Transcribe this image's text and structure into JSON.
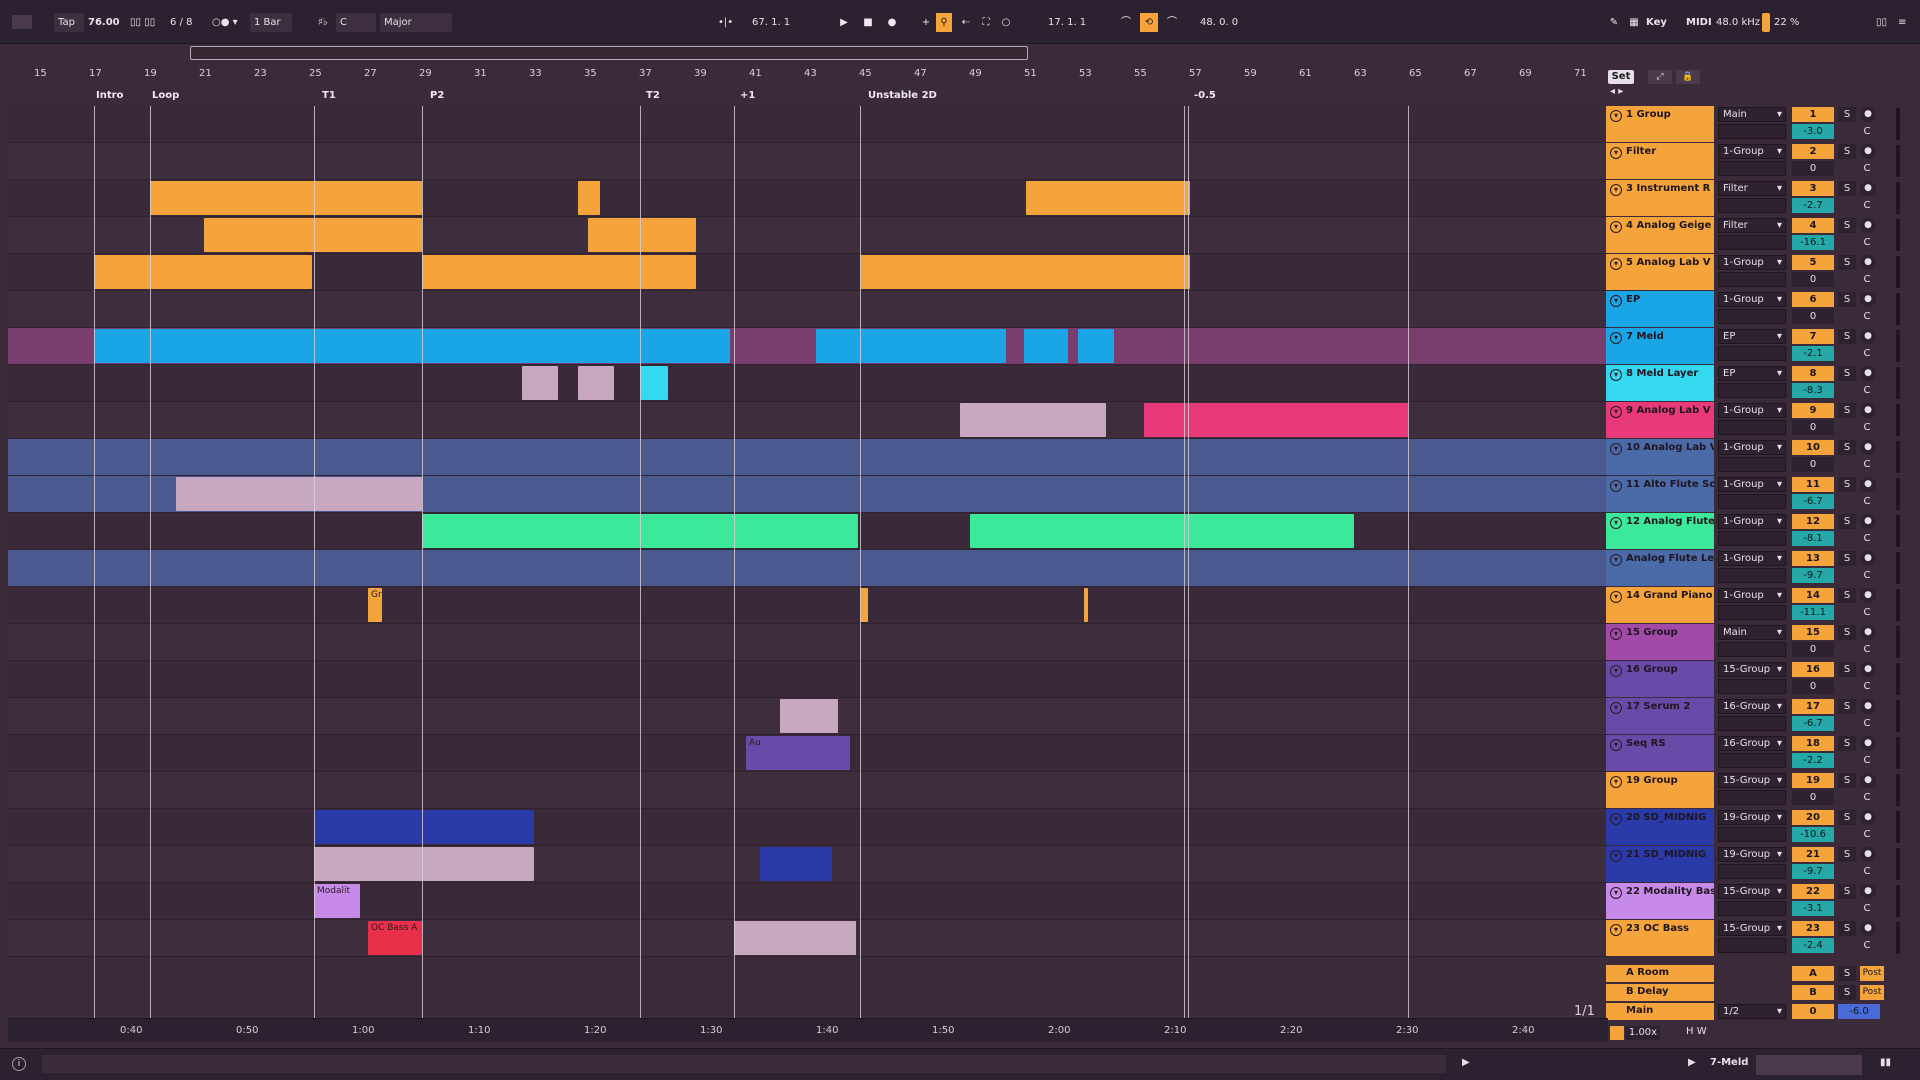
{
  "transport": {
    "tap": "Tap",
    "tempo": "76.00",
    "signature": "6 / 8",
    "quantize": "1 Bar",
    "key": "C",
    "scale": "Major",
    "position": "67.  1.  1",
    "loop_start": "17.  1.  1",
    "loop_length": "48.  0.  0",
    "key_label": "Key",
    "midi_label": "MIDI",
    "sample_rate": "48.0 kHz",
    "cpu": "22 %"
  },
  "ruler": [
    "15",
    "17",
    "19",
    "21",
    "23",
    "25",
    "27",
    "29",
    "31",
    "33",
    "35",
    "37",
    "39",
    "41",
    "43",
    "45",
    "47",
    "49",
    "51",
    "53",
    "55",
    "57",
    "59",
    "61",
    "63",
    "65",
    "67",
    "69",
    "71"
  ],
  "locators": [
    {
      "label": "Intro"
    },
    {
      "label": "Loop"
    },
    {
      "label": "T1"
    },
    {
      "label": "P2"
    },
    {
      "label": "T2"
    },
    {
      "label": "+1"
    },
    {
      "label": "Unstable 2D"
    },
    {
      "label": "-0.5"
    }
  ],
  "set_label": "Set",
  "time_labels": [
    "0:40",
    "0:50",
    "1:00",
    "1:10",
    "1:20",
    "1:30",
    "1:40",
    "1:50",
    "2:00",
    "2:10",
    "2:20",
    "2:30",
    "2:40"
  ],
  "page_indicator": "1/1",
  "zoom": "1.00x",
  "footer_selected": "7-Meld",
  "clip_labels": {
    "gr": "Gr",
    "au": "Au",
    "modality": "Modalit",
    "ocbass": "OC Bass A"
  },
  "tracks": [
    {
      "name": "1 Group",
      "route": "Main",
      "num": "1",
      "vol": "-3.0",
      "color": "#f4a43a"
    },
    {
      "name": "Filter",
      "route": "1-Group",
      "num": "2",
      "vol": "0",
      "color": "#f4a43a"
    },
    {
      "name": "3 Instrument R",
      "route": "Filter",
      "num": "3",
      "vol": "-2.7",
      "color": "#f4a43a"
    },
    {
      "name": "4 Analog Geige",
      "route": "Filter",
      "num": "4",
      "vol": "-16.1",
      "color": "#f4a43a"
    },
    {
      "name": "5 Analog Lab V",
      "route": "1-Group",
      "num": "5",
      "vol": "0",
      "color": "#f4a43a"
    },
    {
      "name": "EP",
      "route": "1-Group",
      "num": "6",
      "vol": "0",
      "color": "#1aa6e6"
    },
    {
      "name": "7 Meld",
      "route": "EP",
      "num": "7",
      "vol": "-2.1",
      "color": "#1aa6e6"
    },
    {
      "name": "8 Meld Layer",
      "route": "EP",
      "num": "8",
      "vol": "-8.3",
      "color": "#34d8f0"
    },
    {
      "name": "9 Analog Lab V",
      "route": "1-Group",
      "num": "9",
      "vol": "0",
      "color": "#e83a7a"
    },
    {
      "name": "10 Analog Lab V",
      "route": "1-Group",
      "num": "10",
      "vol": "0",
      "color": "#4a6aa8"
    },
    {
      "name": "11 Alto Flute Sol",
      "route": "1-Group",
      "num": "11",
      "vol": "-6.7",
      "color": "#4a6aa8"
    },
    {
      "name": "12 Analog Flute",
      "route": "1-Group",
      "num": "12",
      "vol": "-8.1",
      "color": "#3ce89a"
    },
    {
      "name": "Analog Flute Lea",
      "route": "1-Group",
      "num": "13",
      "vol": "-9.7",
      "color": "#4a6aa8"
    },
    {
      "name": "14 Grand Piano",
      "route": "1-Group",
      "num": "14",
      "vol": "-11.1",
      "color": "#f4a43a"
    },
    {
      "name": "15 Group",
      "route": "Main",
      "num": "15",
      "vol": "0",
      "color": "#a24aa8"
    },
    {
      "name": "16 Group",
      "route": "15-Group",
      "num": "16",
      "vol": "0",
      "color": "#6a4aa8"
    },
    {
      "name": "17 Serum 2",
      "route": "16-Group",
      "num": "17",
      "vol": "-6.7",
      "color": "#6a4aa8"
    },
    {
      "name": "Seq RS",
      "route": "16-Group",
      "num": "18",
      "vol": "-2.2",
      "color": "#6a4aa8"
    },
    {
      "name": "19 Group",
      "route": "15-Group",
      "num": "19",
      "vol": "0",
      "color": "#f4a43a"
    },
    {
      "name": "20 SD_MIDNIG",
      "route": "19-Group",
      "num": "20",
      "vol": "-10.6",
      "color": "#2a3aa8"
    },
    {
      "name": "21 SD_MIDNIG",
      "route": "19-Group",
      "num": "21",
      "vol": "-9.7",
      "color": "#2a3aa8"
    },
    {
      "name": "22 Modality Bass",
      "route": "15-Group",
      "num": "22",
      "vol": "-3.1",
      "color": "#c88ae8"
    },
    {
      "name": "23 OC Bass",
      "route": "15-Group",
      "num": "23",
      "vol": "-2.4",
      "color": "#f4a43a"
    }
  ],
  "returns": [
    {
      "name": "A Room",
      "num": "A",
      "post": "Post"
    },
    {
      "name": "B Delay",
      "num": "B",
      "post": "Post"
    },
    {
      "name": "Main",
      "route": "1/2",
      "num": "0",
      "vol": "-6.0"
    }
  ],
  "solo": "S",
  "cue": "C"
}
